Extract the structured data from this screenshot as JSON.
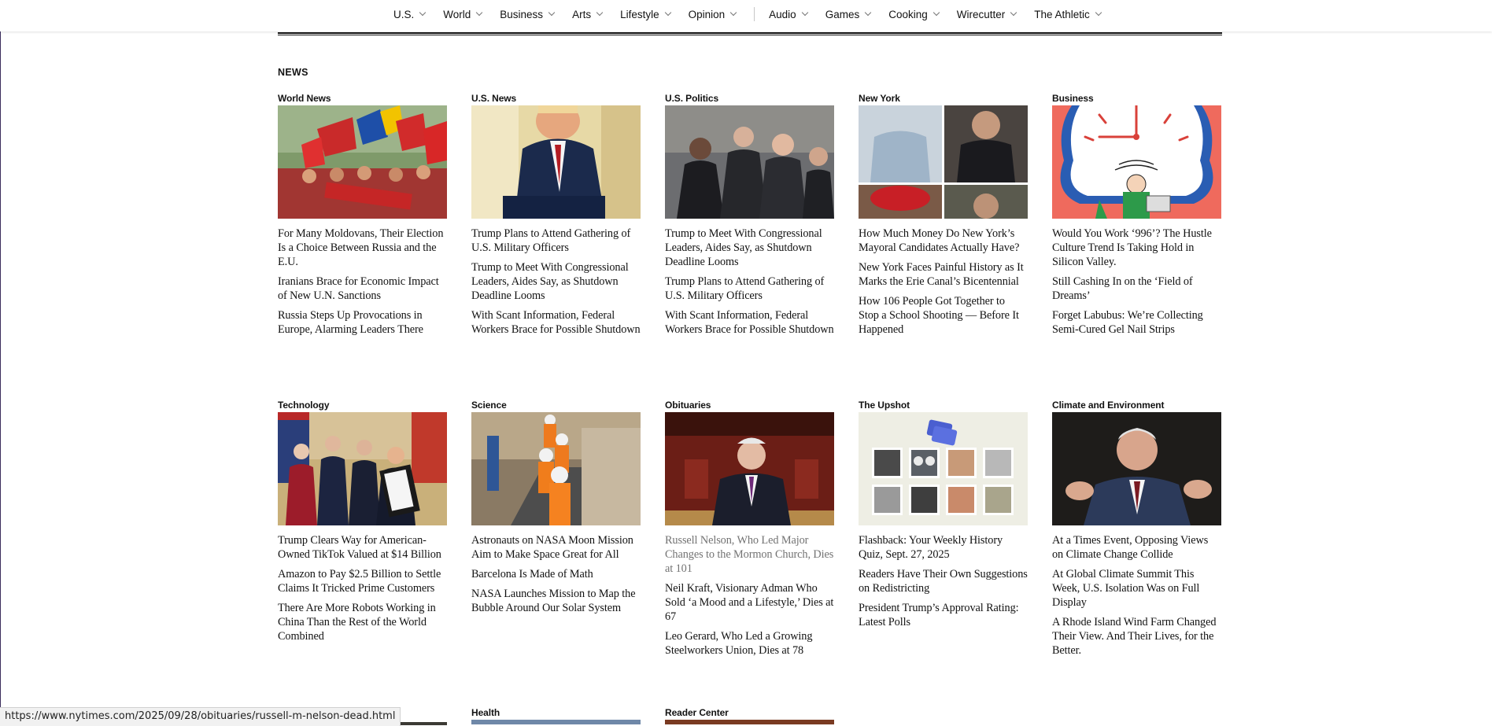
{
  "nav": {
    "items": [
      "U.S.",
      "World",
      "Business",
      "Arts",
      "Lifestyle",
      "Opinion"
    ],
    "items2": [
      "Audio",
      "Games",
      "Cooking",
      "Wirecutter",
      "The Athletic"
    ]
  },
  "news_heading": "NEWS",
  "row1": [
    {
      "section": "World News",
      "image": "moldova-rally-flags-photo",
      "links": [
        "For Many Moldovans, Their Election Is a Choice Between Russia and the E.U.",
        "Iranians Brace for Economic Impact of New U.N. Sanctions",
        "Russia Steps Up Provocations in Europe, Alarming Leaders There"
      ]
    },
    {
      "section": "U.S. News",
      "image": "trump-seated-photo",
      "links": [
        "Trump Plans to Attend Gathering of U.S. Military Officers",
        "Trump to Meet With Congressional Leaders, Aides Say, as Shutdown Deadline Looms",
        "With Scant Information, Federal Workers Brace for Possible Shutdown"
      ]
    },
    {
      "section": "U.S. Politics",
      "image": "congressional-leaders-photo",
      "links": [
        "Trump to Meet With Congressional Leaders, Aides Say, as Shutdown Deadline Looms",
        "Trump Plans to Attend Gathering of U.S. Military Officers",
        "With Scant Information, Federal Workers Brace for Possible Shutdown"
      ]
    },
    {
      "section": "New York",
      "image": "mayoral-candidates-collage",
      "links": [
        "How Much Money Do New York’s Mayoral Candidates Actually Have?",
        "New York Faces Painful History as It Marks the Erie Canal’s Bicentennial",
        "How 106 People Got Together to Stop a School Shooting — Before It Happened"
      ]
    },
    {
      "section": "Business",
      "image": "clock-illustration",
      "links": [
        "Would You Work ‘996’? The Hustle Culture Trend Is Taking Hold in Silicon Valley.",
        "Still Cashing In on the ‘Field of Dreams’",
        "Forget Labubus: We’re Collecting Semi-Cured Gel Nail Strips"
      ]
    }
  ],
  "row2": [
    {
      "section": "Technology",
      "image": "oval-office-signing-photo",
      "links": [
        "Trump Clears Way for American-Owned TikTok Valued at $14 Billion",
        "Amazon to Pay $2.5 Billion to Settle Claims It Tricked Prime Customers",
        "There Are More Robots Working in China Than the Rest of the World Combined"
      ]
    },
    {
      "section": "Science",
      "image": "astronauts-orange-suits-photo",
      "links": [
        "Astronauts on NASA Moon Mission Aim to Make Space Great for All",
        "Barcelona Is Made of Math",
        "NASA Launches Mission to Map the Bubble Around Our Solar System"
      ]
    },
    {
      "section": "Obituaries",
      "image": "russell-nelson-photo",
      "links": [
        "Russell Nelson, Who Led Major Changes to the Mormon Church, Dies at 101",
        "Neil Kraft, Visionary Adman Who Sold ‘a Mood and a Lifestyle,’ Dies at 67",
        "Leo Gerard, Who Led a Growing Steelworkers Union, Dies at 78"
      ]
    },
    {
      "section": "The Upshot",
      "image": "history-quiz-grid",
      "links": [
        "Flashback: Your Weekly History Quiz, Sept. 27, 2025",
        "Readers Have Their Own Suggestions on Redistricting",
        "President Trump’s Approval Rating: Latest Polls"
      ]
    },
    {
      "section": "Climate and Environment",
      "image": "speaker-gesturing-photo",
      "links": [
        "At a Times Event, Opposing Views on Climate Change Collide",
        "At Global Climate Summit This Week, U.S. Isolation Was on Full Display",
        "A Rhode Island Wind Farm Changed Their View. And Their Lives, for the Better."
      ]
    }
  ],
  "row3": [
    {
      "section": ""
    },
    {
      "section": "Health"
    },
    {
      "section": "Reader Center"
    }
  ],
  "status_url": "https://www.nytimes.com/2025/09/28/obituaries/russell-m-nelson-dead.html"
}
